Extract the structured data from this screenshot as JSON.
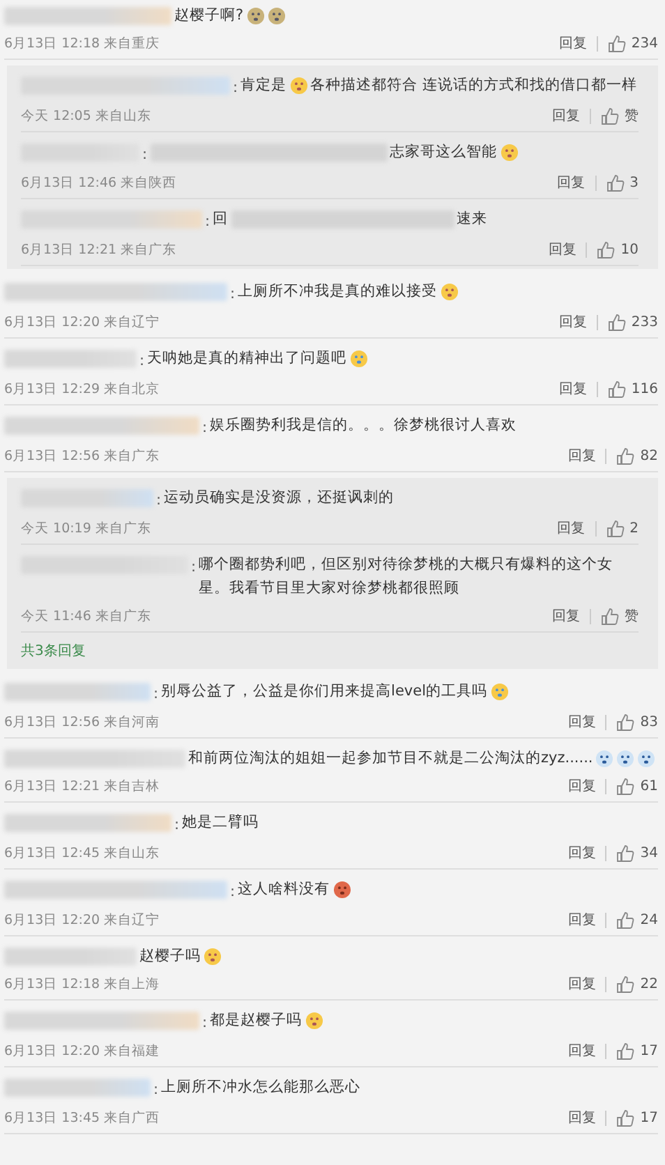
{
  "comments": [
    {
      "segments": [
        {
          "kind": "text",
          "text": "赵樱子啊?"
        },
        {
          "kind": "figure_emoji"
        },
        {
          "kind": "figure_emoji"
        }
      ],
      "meta": "6月13日 12:18 来自重庆",
      "reply_label": "回复",
      "likes": "234",
      "replies": [
        {
          "segments": [
            {
              "kind": "colon",
              "text": ":"
            },
            {
              "kind": "text",
              "text": "肯定是"
            },
            {
              "kind": "shock_emoji"
            },
            {
              "kind": "text",
              "text": "各种描述都符合 连说话的方式和找的借口都一样"
            }
          ],
          "meta": "今天 12:05 来自山东",
          "reply_label": "回复",
          "likes": "赞"
        },
        {
          "segments": [
            {
              "kind": "colon",
              "text": ":"
            },
            {
              "kind": "blur"
            },
            {
              "kind": "text",
              "text": "志家哥这么智能"
            },
            {
              "kind": "grin_emoji"
            }
          ],
          "meta": "6月13日 12:46 来自陕西",
          "reply_label": "回复",
          "likes": "3"
        },
        {
          "segments": [
            {
              "kind": "colon",
              "text": ":"
            },
            {
              "kind": "text",
              "text": "回"
            },
            {
              "kind": "blur"
            },
            {
              "kind": "text",
              "text": "速来"
            }
          ],
          "meta": "6月13日 12:21 来自广东",
          "reply_label": "回复",
          "likes": "10"
        }
      ]
    },
    {
      "segments": [
        {
          "kind": "colon",
          "text": ":"
        },
        {
          "kind": "text",
          "text": "上厕所不冲我是真的难以接受"
        },
        {
          "kind": "shock_emoji"
        }
      ],
      "meta": "6月13日 12:20 来自辽宁",
      "reply_label": "回复",
      "likes": "233"
    },
    {
      "segments": [
        {
          "kind": "colon",
          "text": ":"
        },
        {
          "kind": "text",
          "text": "天呐她是真的精神出了问题吧"
        },
        {
          "kind": "cry_emoji"
        }
      ],
      "meta": "6月13日 12:29 来自北京",
      "reply_label": "回复",
      "likes": "116"
    },
    {
      "segments": [
        {
          "kind": "colon",
          "text": ":"
        },
        {
          "kind": "text",
          "text": "娱乐圈势利我是信的。。。徐梦桃很讨人喜欢"
        }
      ],
      "meta": "6月13日 12:56 来自广东",
      "reply_label": "回复",
      "likes": "82",
      "replies": [
        {
          "segments": [
            {
              "kind": "colon",
              "text": ":"
            },
            {
              "kind": "text",
              "text": "运动员确实是没资源，还挺讽刺的"
            }
          ],
          "meta": "今天 10:19 来自广东",
          "reply_label": "回复",
          "likes": "2"
        },
        {
          "segments": [
            {
              "kind": "colon",
              "text": ":"
            },
            {
              "kind": "text",
              "text": "哪个圈都势利吧，但区别对待徐梦桃的大概只有爆料的这个女星。我看节目里大家对徐梦桃都很照顾"
            }
          ],
          "meta": "今天 11:46 来自广东",
          "reply_label": "回复",
          "likes": "赞"
        }
      ],
      "more_replies": "共3条回复"
    },
    {
      "segments": [
        {
          "kind": "colon",
          "text": ":"
        },
        {
          "kind": "text",
          "text": "别辱公益了，公益是你们用来提高level的工具吗"
        },
        {
          "kind": "cry_emoji"
        }
      ],
      "meta": "6月13日 12:56 来自河南",
      "reply_label": "回复",
      "likes": "83"
    },
    {
      "segments": [
        {
          "kind": "text",
          "text": "和前两位淘汰的姐姐一起参加节目不就是二公淘汰的zyz......"
        },
        {
          "kind": "blue_emoji"
        },
        {
          "kind": "blue_emoji"
        },
        {
          "kind": "blue_emoji"
        }
      ],
      "meta": "6月13日 12:21 来自吉林",
      "reply_label": "回复",
      "likes": "61"
    },
    {
      "segments": [
        {
          "kind": "colon",
          "text": ":"
        },
        {
          "kind": "text",
          "text": "她是二臂吗"
        }
      ],
      "meta": "6月13日 12:45 来自山东",
      "reply_label": "回复",
      "likes": "34"
    },
    {
      "segments": [
        {
          "kind": "colon",
          "text": ":"
        },
        {
          "kind": "text",
          "text": "这人啥料没有"
        },
        {
          "kind": "red_emoji"
        }
      ],
      "meta": "6月13日 12:20 来自辽宁",
      "reply_label": "回复",
      "likes": "24"
    },
    {
      "segments": [
        {
          "kind": "text",
          "text": "赵樱子吗"
        },
        {
          "kind": "shock_emoji"
        }
      ],
      "meta": "6月13日 12:18 来自上海",
      "reply_label": "回复",
      "likes": "22"
    },
    {
      "segments": [
        {
          "kind": "colon",
          "text": ":"
        },
        {
          "kind": "text",
          "text": "都是赵樱子吗"
        },
        {
          "kind": "shock_emoji"
        }
      ],
      "meta": "6月13日 12:20 来自福建",
      "reply_label": "回复",
      "likes": "17"
    },
    {
      "segments": [
        {
          "kind": "colon",
          "text": ":"
        },
        {
          "kind": "text",
          "text": "上厕所不冲水怎么能那么恶心"
        }
      ],
      "meta": "6月13日 13:45 来自广西",
      "reply_label": "回复",
      "likes": "17"
    }
  ]
}
